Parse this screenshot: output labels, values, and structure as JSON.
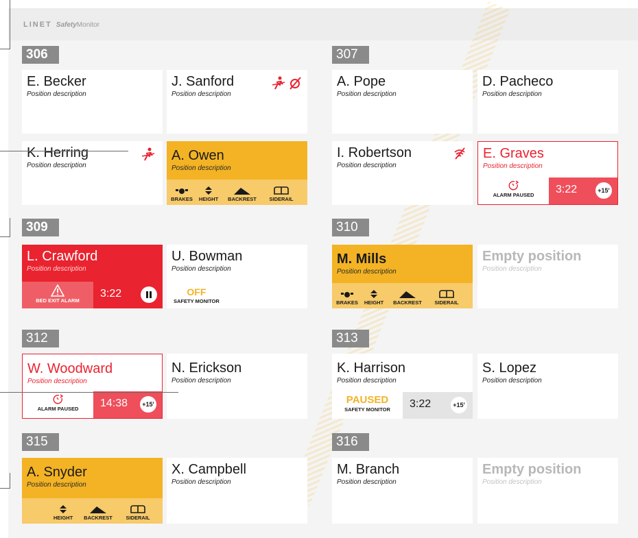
{
  "header": {
    "brand": "LINET",
    "product_bold": "Safety",
    "product_rest": "Monitor"
  },
  "colors": {
    "warning": "#f3b324",
    "alarm": "#e9232f",
    "paused_red": "#ef4e5b",
    "tag_gray": "#8a8a8a"
  },
  "rooms": {
    "r306": "306",
    "r307": "307",
    "r309": "309",
    "r310": "310",
    "r312": "312",
    "r313": "313",
    "r315": "315",
    "r316": "316"
  },
  "beds": {
    "becker": {
      "name": "E. Becker",
      "desc": "Position description"
    },
    "sanford": {
      "name": "J. Sanford",
      "desc": "Position description",
      "icons": [
        "no-person-icon",
        "no-signal-icon"
      ]
    },
    "pope": {
      "name": "A. Pope",
      "desc": "Position description"
    },
    "pacheco": {
      "name": "D. Pacheco",
      "desc": "Position description"
    },
    "herring": {
      "name": "K. Herring",
      "desc": "Position description",
      "icons": [
        "no-person-icon"
      ]
    },
    "owen": {
      "name": "A. Owen",
      "desc": "Position description"
    },
    "robertson": {
      "name": "I. Robertson",
      "desc": "Position description",
      "icons": [
        "no-wifi-icon"
      ]
    },
    "graves": {
      "name": "E. Graves",
      "desc": "Position description",
      "status": "ALARM PAUSED",
      "timer": "3:22",
      "badge": "+15'"
    },
    "crawford": {
      "name": "L. Crawford",
      "desc": "Position description",
      "status": "BED EXIT ALARM",
      "timer": "3:22"
    },
    "bowman": {
      "name": "U. Bowman",
      "desc": "Position description",
      "off": "OFF",
      "off_label": "SAFETY MONITOR"
    },
    "mills": {
      "name": "M. Mills",
      "desc": "Position description"
    },
    "empty310": {
      "name": "Empty position",
      "desc": "Position description"
    },
    "woodward": {
      "name": "W. Woodward",
      "desc": "Position description",
      "status": "ALARM PAUSED",
      "timer": "14:38",
      "badge": "+15'"
    },
    "erickson": {
      "name": "N. Erickson",
      "desc": "Position description"
    },
    "harrison": {
      "name": "K. Harrison",
      "desc": "Position description",
      "paused": "PAUSED",
      "paused_label": "SAFETY MONITOR",
      "timer": "3:22",
      "badge": "+15'"
    },
    "lopez": {
      "name": "S. Lopez",
      "desc": "Position description"
    },
    "snyder": {
      "name": "A. Snyder",
      "desc": "Position description"
    },
    "campbell": {
      "name": "X. Campbell",
      "desc": "Position description"
    },
    "branch": {
      "name": "M. Branch",
      "desc": "Position description"
    },
    "empty316": {
      "name": "Empty position",
      "desc": "Position description"
    }
  },
  "indicators": {
    "brakes": "BRAKES",
    "height": "HEIGHT",
    "backrest": "BACKREST",
    "siderail": "SIDERAIL"
  }
}
